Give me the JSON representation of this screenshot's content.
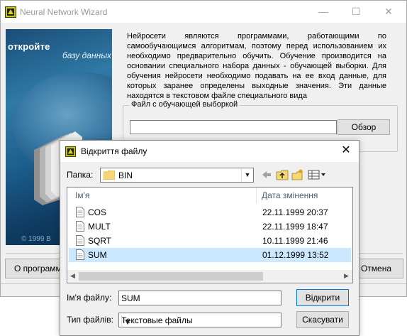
{
  "wizard": {
    "title": "Neural Network Wizard",
    "splash": {
      "headline": "откройте",
      "subline": "базу данных",
      "copyright": "© 1999 B"
    },
    "intro_text": "Нейросети являются программами, работающими по самообучающимся алгоритмам, поэтому перед использованием их необходимо предварительно обучить. Обучение производится на основании специального набора данных - обучающей выборки. Для обучения нейросети необходимо подавать на ее вход данные, для которых заранее определены выходные значения. Эти данные находятся в текстовом файле специального вида",
    "group_label": "Файл с обучающей выборкой",
    "browse_button": "Обзор",
    "about_button": "О программе",
    "cancel_button": "Отмена"
  },
  "dialog": {
    "title": "Відкриття файлу",
    "folder_label": "Папка:",
    "current_folder": "BIN",
    "columns": {
      "name": "Ім'я",
      "date": "Дата змінення"
    },
    "files": [
      {
        "name": "COS",
        "date": "22.11.1999 20:37",
        "selected": false
      },
      {
        "name": "MULT",
        "date": "22.11.1999 18:47",
        "selected": false
      },
      {
        "name": "SQRT",
        "date": "10.11.1999 21:46",
        "selected": false
      },
      {
        "name": "SUM",
        "date": "01.12.1999 13:52",
        "selected": true
      }
    ],
    "filename_label": "Ім'я файлу:",
    "filename_value": "SUM",
    "filetype_label": "Тип файлів:",
    "filetype_value": "Текстовые файлы",
    "open_button": "Відкрити",
    "cancel_button": "Скасувати"
  },
  "icons": {
    "minimize": "minimize-icon",
    "maximize": "maximize-icon",
    "close": "close-icon",
    "back": "back-arrow-icon",
    "up": "up-folder-icon",
    "new_folder": "new-folder-icon",
    "view": "view-menu-icon"
  },
  "colors": {
    "selection": "#cce8ff",
    "default_button_border": "#0078d7",
    "column_header": "#4c607a"
  }
}
